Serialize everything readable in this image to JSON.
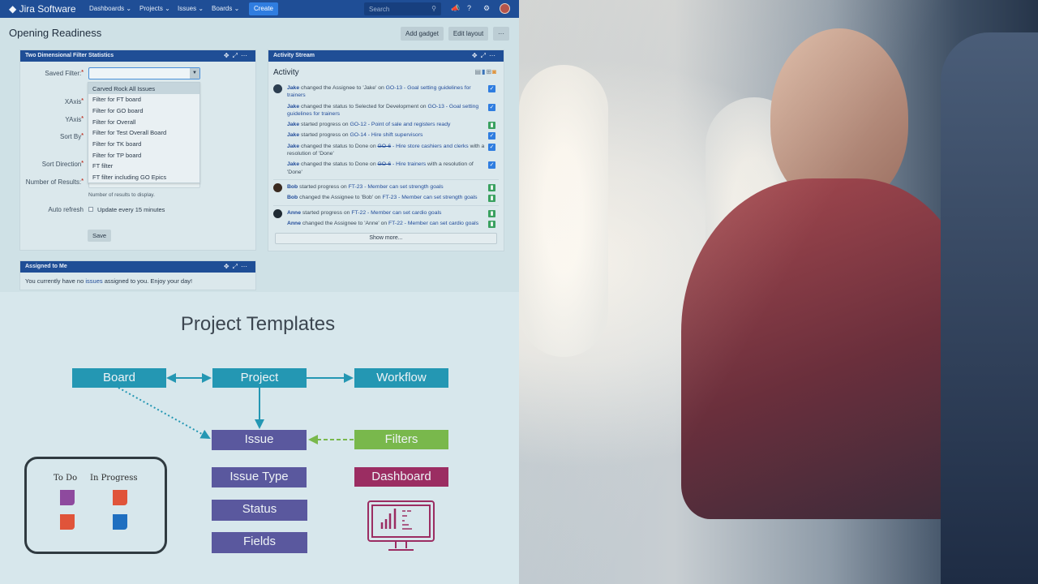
{
  "header": {
    "logo": "Jira Software",
    "nav": [
      "Dashboards",
      "Projects",
      "Issues",
      "Boards"
    ],
    "create": "Create",
    "search_placeholder": "Search"
  },
  "page": {
    "title": "Opening Readiness",
    "add_gadget": "Add gadget",
    "edit_layout": "Edit layout",
    "more": "···"
  },
  "filter_gadget": {
    "title": "Two Dimensional Filter Statistics",
    "labels": {
      "saved_filter": "Saved Filter:",
      "xaxis": "XAxis",
      "yaxis": "YAxis",
      "sort_by": "Sort By",
      "sort_direction": "Sort Direction",
      "num_results": "Number of Results:",
      "auto_refresh": "Auto refresh"
    },
    "saved_filter_value": "",
    "options": [
      "Carved Rock All Issues",
      "Filter for FT board",
      "Filter for GO board",
      "Filter for Overall",
      "Filter for Test Overall Board",
      "Filter for TK board",
      "Filter for TP board",
      "FT filter",
      "FT filter including GO Epics"
    ],
    "num_results_help": "Number of results to display.",
    "auto_refresh_label": "Update every 15 minutes",
    "auto_refresh_checked": false,
    "save": "Save"
  },
  "activity_gadget": {
    "title": "Activity Stream",
    "heading": "Activity",
    "show_more": "Show more...",
    "items": [
      {
        "actor": "Jake",
        "pre": " changed the Assignee to 'Jake' on ",
        "link": "GO-13 - Goal setting guidelines for trainers",
        "post": "",
        "icon": "task",
        "resolved": false
      },
      {
        "actor": "Jake",
        "pre": " changed the status to Selected for Development on ",
        "link": "GO-13 - Goal setting guidelines for trainers",
        "post": "",
        "icon": "task",
        "resolved": false
      },
      {
        "actor": "Jake",
        "pre": " started progress on ",
        "link": "GO-12 - Point of sale and registers ready",
        "post": "",
        "icon": "story",
        "resolved": false
      },
      {
        "actor": "Jake",
        "pre": " started progress on ",
        "link": "GO-14 - Hire shift supervisors",
        "post": "",
        "icon": "task",
        "resolved": false
      },
      {
        "actor": "Jake",
        "pre": " changed the status to Done on ",
        "link_key": "GO-6",
        "link": " - Hire store cashiers and clerks",
        "post": " with a resolution of 'Done'",
        "icon": "task",
        "resolved": true
      },
      {
        "actor": "Jake",
        "pre": " changed the status to Done on ",
        "link_key": "GO-6",
        "link": " - Hire trainers",
        "post": " with a resolution of 'Done'",
        "icon": "task",
        "resolved": true
      },
      {
        "actor": "Bob",
        "pre": " started progress on ",
        "link": "FT-23 - Member can set strength goals",
        "post": "",
        "icon": "story",
        "resolved": false
      },
      {
        "actor": "Bob",
        "pre": " changed the Assignee to 'Bob' on ",
        "link": "FT-23 - Member can set strength goals",
        "post": "",
        "icon": "story",
        "resolved": false
      },
      {
        "actor": "Anne",
        "pre": " started progress on ",
        "link": "FT-22 - Member can set cardio goals",
        "post": "",
        "icon": "story",
        "resolved": false
      },
      {
        "actor": "Anne",
        "pre": " changed the Assignee to 'Anne' on ",
        "link": "FT-22 - Member can set cardio goals",
        "post": "",
        "icon": "story",
        "resolved": false
      }
    ]
  },
  "assigned_gadget": {
    "title": "Assigned to Me",
    "pre": "You currently have no ",
    "link": "issues",
    "post": " assigned to you. Enjoy your day!"
  },
  "diagram": {
    "title": "Project Templates",
    "boxes": {
      "board": "Board",
      "project": "Project",
      "workflow": "Workflow",
      "issue": "Issue",
      "filters": "Filters",
      "issue_type": "Issue Type",
      "status": "Status",
      "fields": "Fields",
      "dashboard": "Dashboard"
    },
    "kanban": {
      "todo": "To Do",
      "in_progress": "In Progress"
    }
  },
  "colors": {
    "jira_blue": "#1f4e96",
    "teal": "#2497b3",
    "purple": "#5a589e",
    "green": "#79b84c",
    "magenta": "#9b2d62",
    "task": "#2f7de0",
    "story": "#3aa160"
  }
}
